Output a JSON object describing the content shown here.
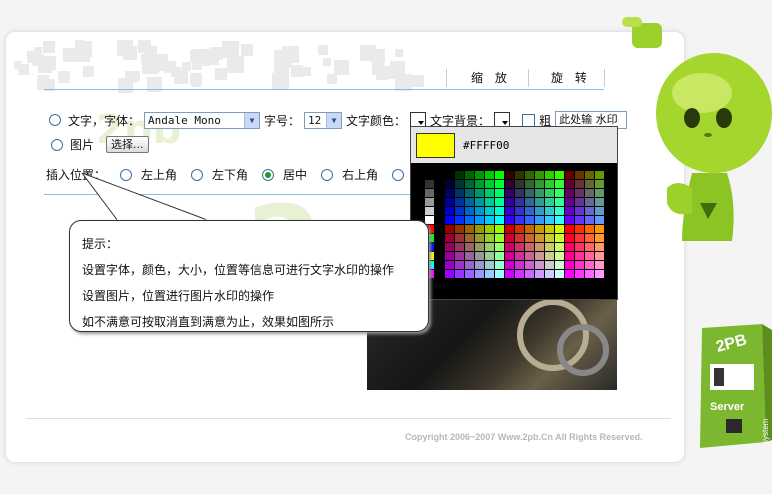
{
  "toolbar": {
    "zoom_label": "缩 放",
    "rotate_label": "旋 转"
  },
  "text_row": {
    "radio_label": "文字，字体：",
    "font_select": "Andale Mono",
    "size_label": "字号：",
    "size_select": "12",
    "color_label": "文字颜色：",
    "bg_label": "文字背景：",
    "bold_label": "粗",
    "text_input": "此处输 水印"
  },
  "image_row": {
    "radio_label": "图片",
    "choose_button": "选择..."
  },
  "position_row": {
    "label": "插入位置：",
    "options": [
      "左上角",
      "左下角",
      "居中",
      "右上角",
      "右"
    ],
    "selected": "居中"
  },
  "color_picker": {
    "hex": "#FFFF00",
    "preview_color": "#FFFF00"
  },
  "tip": {
    "title": "提示：",
    "lines": [
      "设置字体，颜色，大小，位置等信息可进行文字水印的操作",
      "设置图片，位置进行图片水印的操作",
      "如不满意可按取消直到满意为止，效果如图所示"
    ]
  },
  "watermark": {
    "main": "2pb",
    "suffix": "CN"
  },
  "footer": {
    "copyright": "Copyright 2006~2007 Www.2pb.Cn All Rights Reserved."
  },
  "server_badge": {
    "brand": "2PB",
    "label": "Server",
    "side": "system"
  },
  "colors": {
    "accent_green": "#9acd32",
    "rule_blue": "#7cc5e2",
    "bg": "#f4f4f4"
  }
}
